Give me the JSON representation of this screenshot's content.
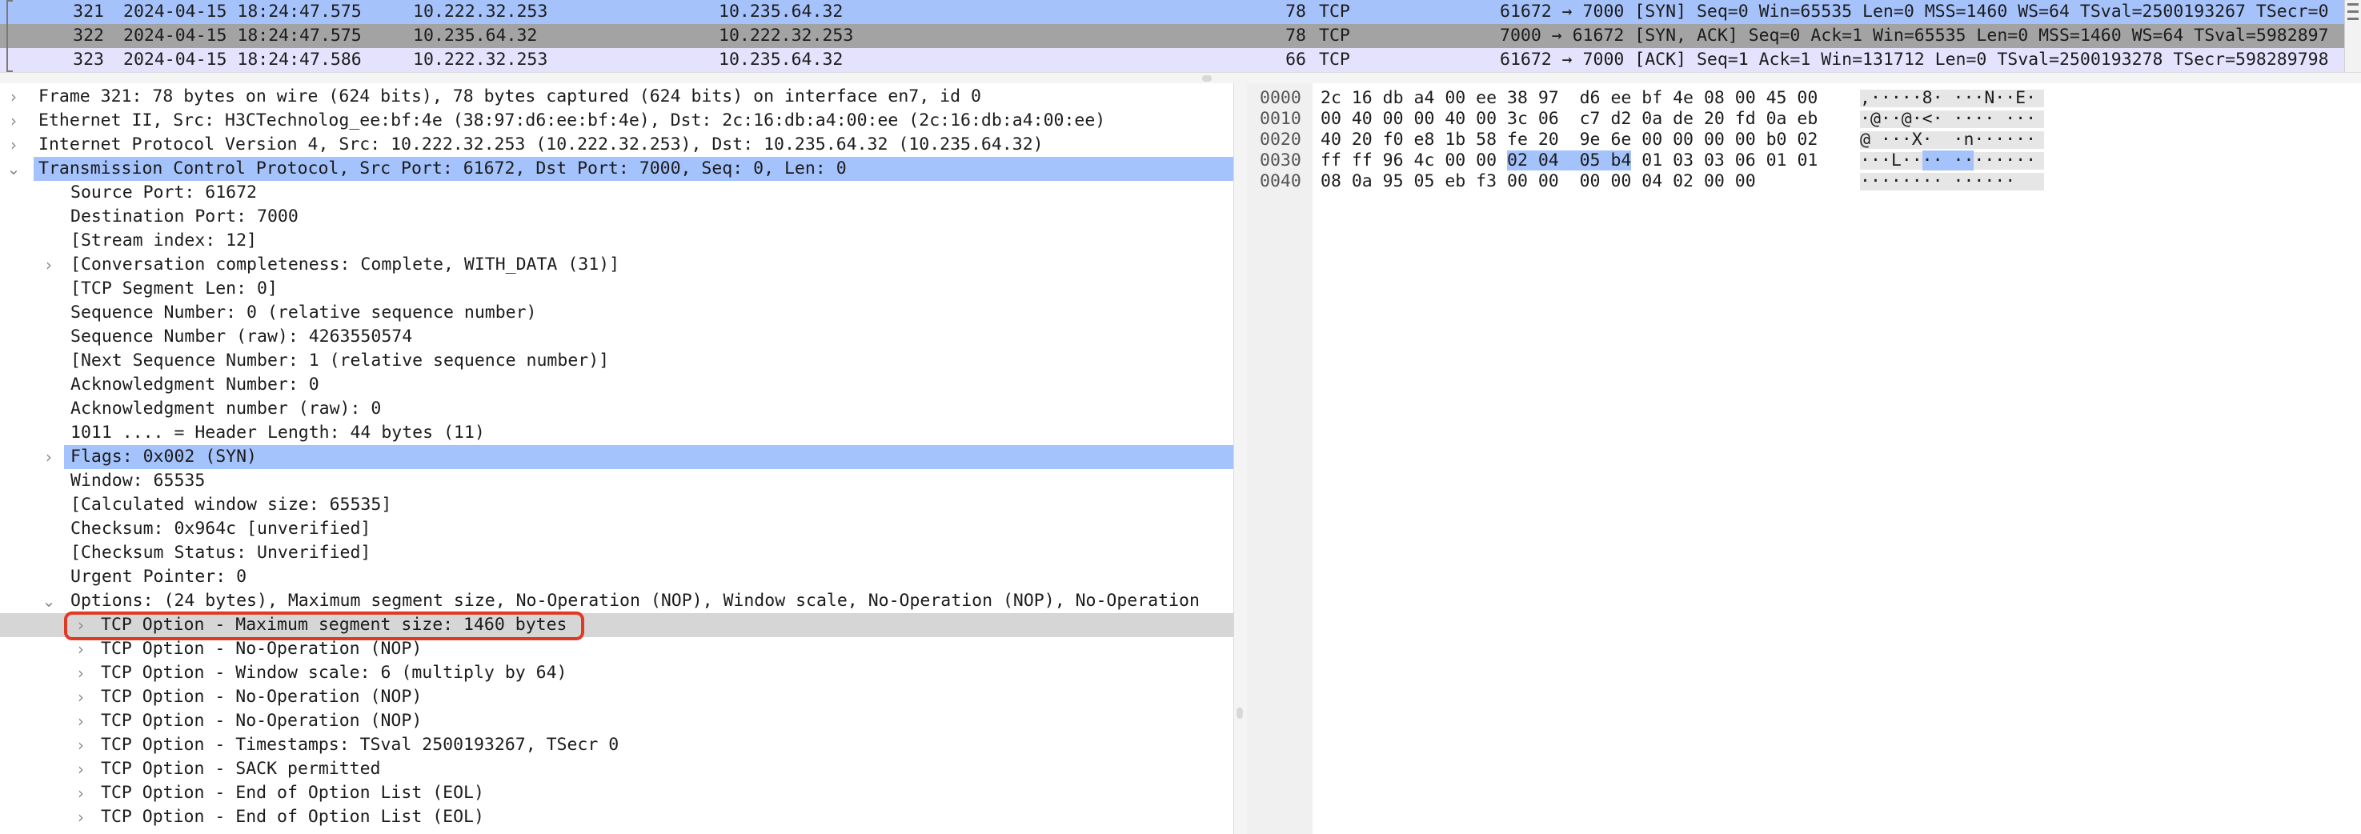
{
  "packet_list": {
    "rows": [
      {
        "no": "321",
        "time": "2024-04-15 18:24:47.575",
        "src": "10.222.32.253",
        "dst": "10.235.64.32",
        "len": "78",
        "proto": "TCP",
        "info": "61672 → 7000 [SYN] Seq=0 Win=65535 Len=0 MSS=1460 WS=64 TSval=2500193267 TSecr=0"
      },
      {
        "no": "322",
        "time": "2024-04-15 18:24:47.575",
        "src": "10.235.64.32",
        "dst": "10.222.32.253",
        "len": "78",
        "proto": "TCP",
        "info": "7000 → 61672 [SYN, ACK] Seq=0 Ack=1 Win=65535 Len=0 MSS=1460 WS=64 TSval=5982897"
      },
      {
        "no": "323",
        "time": "2024-04-15 18:24:47.586",
        "src": "10.222.32.253",
        "dst": "10.235.64.32",
        "len": "66",
        "proto": "TCP",
        "info": "61672 → 7000 [ACK] Seq=1 Ack=1 Win=131712 Len=0 TSval=2500193278 TSecr=598289798"
      }
    ]
  },
  "details": {
    "frame": "Frame 321: 78 bytes on wire (624 bits), 78 bytes captured (624 bits) on interface en7, id 0",
    "ethernet": "Ethernet II, Src: H3CTechnolog_ee:bf:4e (38:97:d6:ee:bf:4e), Dst: 2c:16:db:a4:00:ee (2c:16:db:a4:00:ee)",
    "ip": "Internet Protocol Version 4, Src: 10.222.32.253 (10.222.32.253), Dst: 10.235.64.32 (10.235.64.32)",
    "tcp": "Transmission Control Protocol, Src Port: 61672, Dst Port: 7000, Seq: 0, Len: 0",
    "src_port": "Source Port: 61672",
    "dst_port": "Destination Port: 7000",
    "stream_index": "[Stream index: 12]",
    "conversation": "[Conversation completeness: Complete, WITH_DATA (31)]",
    "segment_len": "[TCP Segment Len: 0]",
    "seq": "Sequence Number: 0    (relative sequence number)",
    "seq_raw": "Sequence Number (raw): 4263550574",
    "next_seq": "[Next Sequence Number: 1    (relative sequence number)]",
    "ack": "Acknowledgment Number: 0",
    "ack_raw": "Acknowledgment number (raw): 0",
    "header_len": "1011 .... = Header Length: 44 bytes (11)",
    "flags": "Flags: 0x002 (SYN)",
    "window": "Window: 65535",
    "calc_window": "[Calculated window size: 65535]",
    "checksum": "Checksum: 0x964c [unverified]",
    "checksum_status": "[Checksum Status: Unverified]",
    "urgent": "Urgent Pointer: 0",
    "options": "Options: (24 bytes), Maximum segment size, No-Operation (NOP), Window scale, No-Operation (NOP), No-Operation",
    "opt_mss": "TCP Option - Maximum segment size: 1460 bytes",
    "opt_nop1": "TCP Option - No-Operation (NOP)",
    "opt_ws": "TCP Option - Window scale: 6 (multiply by 64)",
    "opt_nop2": "TCP Option - No-Operation (NOP)",
    "opt_nop3": "TCP Option - No-Operation (NOP)",
    "opt_ts": "TCP Option - Timestamps: TSval 2500193267, TSecr 0",
    "opt_sack": "TCP Option - SACK permitted",
    "opt_eol1": "TCP Option - End of Option List (EOL)",
    "opt_eol2": "TCP Option - End of Option List (EOL)"
  },
  "hex": {
    "lines": [
      {
        "off": "0000",
        "a": "2c 16 db a4 00 ee 38 97",
        "hl": "",
        "b": "d6 ee bf 4e 08 00 45 00",
        "ascii_a": ",·····8·",
        "ascii_hl": "",
        "ascii_b": " ···N··E·"
      },
      {
        "off": "0010",
        "a": "00 40 00 00 40 00 3c 06",
        "hl": "",
        "b": "c7 d2 0a de 20 fd 0a eb",
        "ascii_a": "·@··@·<·",
        "ascii_hl": "",
        "ascii_b": " ···· ···"
      },
      {
        "off": "0020",
        "a": "40 20 f0 e8 1b 58 fe 20",
        "hl": "",
        "b": "9e 6e 00 00 00 00 b0 02",
        "ascii_a": "@ ···X· ",
        "ascii_hl": "",
        "ascii_b": " ·n······"
      },
      {
        "off": "0030",
        "a": "ff ff 96 4c 00 00 ",
        "hl": "02 04  05 b4",
        "b": " 01 03 03 06 01 01",
        "ascii_a": "···L··",
        "ascii_hl": "·· ··",
        "ascii_b": "······"
      },
      {
        "off": "0040",
        "a": "08 0a 95 05 eb f3 00 00",
        "hl": "",
        "b": "00 00 04 02 00 00",
        "ascii_a": "········",
        "ascii_hl": "",
        "ascii_b": " ······"
      }
    ]
  },
  "colors": {
    "selection_blue": "#a4c2fb",
    "highlight_red": "#e03a24",
    "row_gray": "#a3a3a3"
  }
}
